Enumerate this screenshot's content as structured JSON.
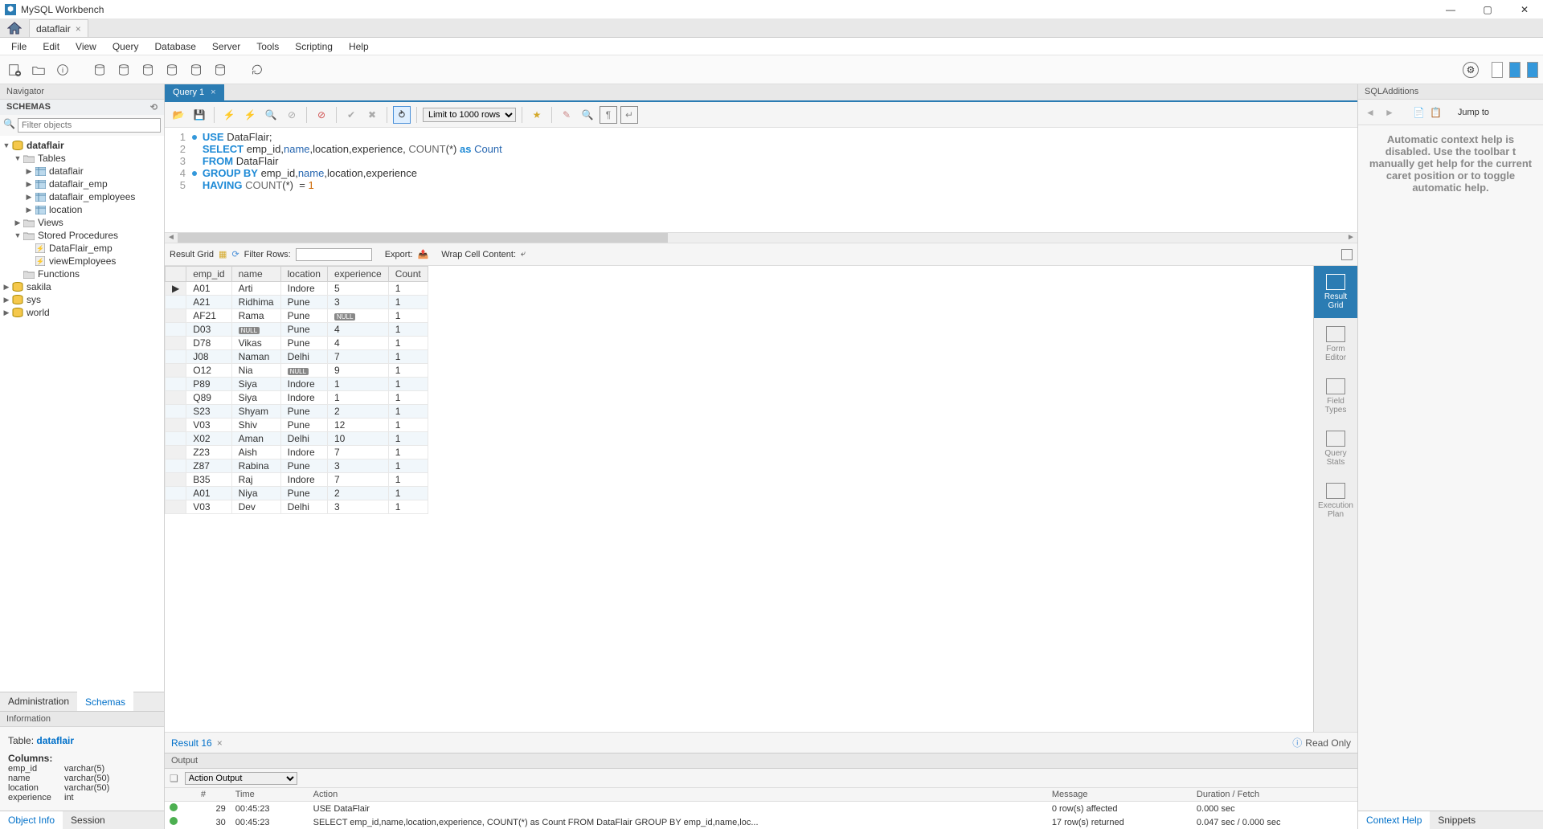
{
  "app_title": "MySQL Workbench",
  "connection_tab": "dataflair",
  "menu": [
    "File",
    "Edit",
    "View",
    "Query",
    "Database",
    "Server",
    "Tools",
    "Scripting",
    "Help"
  ],
  "navigator": {
    "title": "Navigator",
    "schemas_label": "SCHEMAS",
    "filter_placeholder": "Filter objects"
  },
  "tree": {
    "db": "dataflair",
    "tables_label": "Tables",
    "tables": [
      "dataflair",
      "dataflair_emp",
      "dataflair_employees",
      "location"
    ],
    "views_label": "Views",
    "sp_label": "Stored Procedures",
    "sp": [
      "DataFlair_emp",
      "viewEmployees"
    ],
    "fn_label": "Functions",
    "other_db": [
      "sakila",
      "sys",
      "world"
    ]
  },
  "sidebar_tabs": {
    "admin": "Administration",
    "schemas": "Schemas"
  },
  "info": {
    "header": "Information",
    "table_label": "Table:",
    "table_name": "dataflair",
    "columns_label": "Columns:",
    "cols": [
      {
        "n": "emp_id",
        "t": "varchar(5)"
      },
      {
        "n": "name",
        "t": "varchar(50)"
      },
      {
        "n": "location",
        "t": "varchar(50)"
      },
      {
        "n": "experience",
        "t": "int"
      }
    ]
  },
  "bottom_tabs": {
    "object": "Object Info",
    "session": "Session"
  },
  "query_tab": "Query 1",
  "limit_label": "Limit to 1000 rows",
  "sql_lines": [
    {
      "n": 1,
      "dot": true,
      "h": "<span class='kw'>USE</span> DataFlair;"
    },
    {
      "n": 2,
      "h": "<span class='kw'>SELECT</span> emp_id,<span class='ident'>name</span>,location,experience, <span class='fn'>COUNT</span>(*) <span class='kw'>as</span> <span class='ident'>Count</span>"
    },
    {
      "n": 3,
      "h": "<span class='kw'>FROM</span> DataFlair"
    },
    {
      "n": 4,
      "dot": true,
      "h": "<span class='kw'>GROUP BY</span> emp_id,<span class='ident'>name</span>,location,experience"
    },
    {
      "n": 5,
      "h": "<span class='kw'>HAVING</span> <span class='fn'>COUNT</span>(*)  = <span class='num'>1</span>"
    }
  ],
  "result_toolbar": {
    "grid": "Result Grid",
    "filter": "Filter Rows:",
    "export": "Export:",
    "wrap": "Wrap Cell Content:"
  },
  "chart_data": {
    "type": "table",
    "columns": [
      "emp_id",
      "name",
      "location",
      "experience",
      "Count"
    ],
    "rows": [
      [
        "A01",
        "Arti",
        "Indore",
        "5",
        "1"
      ],
      [
        "A21",
        "Ridhima",
        "Pune",
        "3",
        "1"
      ],
      [
        "AF21",
        "Rama",
        "Pune",
        null,
        "1"
      ],
      [
        "D03",
        null,
        "Pune",
        "4",
        "1"
      ],
      [
        "D78",
        "Vikas",
        "Pune",
        "4",
        "1"
      ],
      [
        "J08",
        "Naman",
        "Delhi",
        "7",
        "1"
      ],
      [
        "O12",
        "Nia",
        null,
        "9",
        "1"
      ],
      [
        "P89",
        "Siya",
        "Indore",
        "1",
        "1"
      ],
      [
        "Q89",
        "Siya",
        "Indore",
        "1",
        "1"
      ],
      [
        "S23",
        "Shyam",
        "Pune",
        "2",
        "1"
      ],
      [
        "V03",
        "Shiv",
        "Pune",
        "12",
        "1"
      ],
      [
        "X02",
        "Aman",
        "Delhi",
        "10",
        "1"
      ],
      [
        "Z23",
        "Aish",
        "Indore",
        "7",
        "1"
      ],
      [
        "Z87",
        "Rabina",
        "Pune",
        "3",
        "1"
      ],
      [
        "B35",
        "Raj",
        "Indore",
        "7",
        "1"
      ],
      [
        "A01",
        "Niya",
        "Pune",
        "2",
        "1"
      ],
      [
        "V03",
        "Dev",
        "Delhi",
        "3",
        "1"
      ]
    ]
  },
  "result_sidebar": [
    "Result Grid",
    "Form Editor",
    "Field Types",
    "Query Stats",
    "Execution Plan"
  ],
  "result_tab": "Result 16",
  "read_only": "Read Only",
  "output": {
    "header": "Output",
    "dropdown": "Action Output",
    "cols": [
      "",
      "#",
      "Time",
      "Action",
      "Message",
      "Duration / Fetch"
    ],
    "rows": [
      {
        "n": "29",
        "t": "00:45:23",
        "a": "USE DataFlair",
        "m": "0 row(s) affected",
        "d": "0.000 sec"
      },
      {
        "n": "30",
        "t": "00:45:23",
        "a": "SELECT emp_id,name,location,experience, COUNT(*) as Count FROM DataFlair GROUP BY emp_id,name,loc...",
        "m": "17 row(s) returned",
        "d": "0.047 sec / 0.000 sec"
      }
    ]
  },
  "additions": {
    "header": "SQLAdditions",
    "jump": "Jump to",
    "body": "Automatic context help is disabled. Use the toolbar t manually get help for the current caret position or to toggle automatic help.",
    "tabs": {
      "context": "Context Help",
      "snippets": "Snippets"
    }
  }
}
